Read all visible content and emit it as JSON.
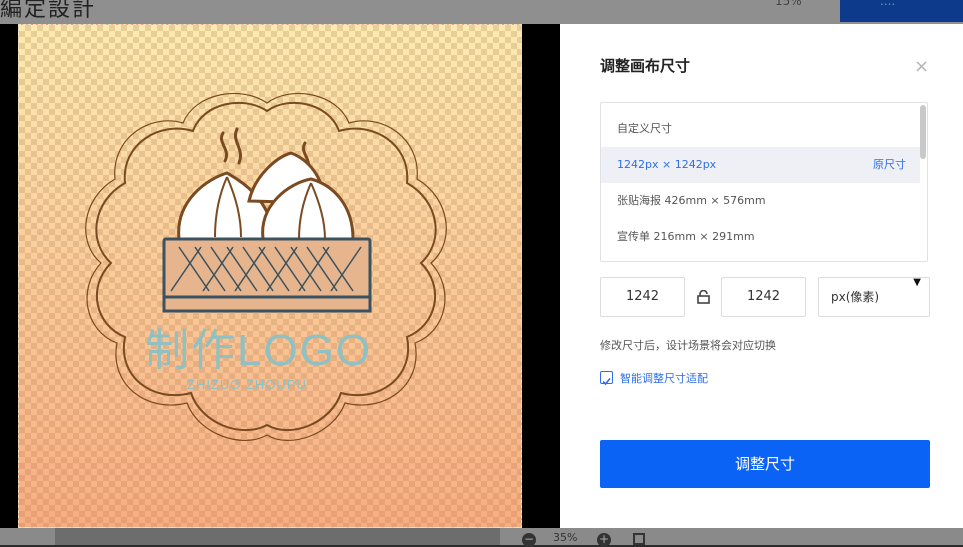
{
  "topbar": {
    "title": "編定設計",
    "zoom_text": "15%",
    "button_label": "...."
  },
  "canvas": {
    "logo_main_text": "制作LOGO",
    "logo_sub_text": "ZHIZUO ZHOUPU",
    "colors": {
      "gradient_top": "#f6d98a",
      "gradient_bottom": "#e99b78",
      "outline": "#7a4a21",
      "main_text": "#8fc0c4",
      "basket": "#e6b48d",
      "basket_stroke": "#3b5261"
    }
  },
  "dialog": {
    "title": "调整画布尺寸",
    "close_icon": "close-icon",
    "sizes": [
      {
        "label": "自定义尺寸",
        "selected": false
      },
      {
        "label": "1242px × 1242px",
        "selected": true,
        "tag": "原尺寸"
      },
      {
        "label": "张贴海报 426mm × 576mm",
        "selected": false
      },
      {
        "label": "宣传单 216mm × 291mm",
        "selected": false
      }
    ],
    "width_value": "1242",
    "height_value": "1242",
    "lock_icon": "unlock-icon",
    "unit": "px(像素)",
    "note": "修改尺寸后，设计场景将会对应切换",
    "smart_fit_checked": true,
    "smart_fit_label": "智能调整尺寸适配",
    "submit_label": "调整尺寸",
    "accent_color": "#0b63f6"
  },
  "bottombar": {
    "zoom": "35%",
    "zoom_out": "−",
    "zoom_in": "+"
  }
}
